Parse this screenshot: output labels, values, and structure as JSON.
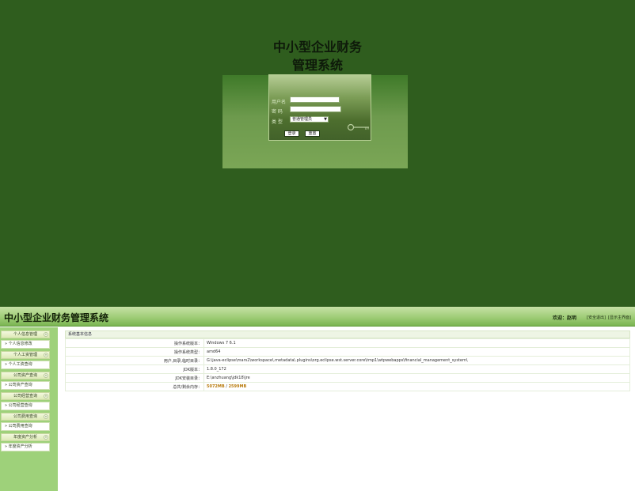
{
  "login": {
    "title_line1": "中小型企业财务",
    "title_line2": "管理系统",
    "username_label": "用户名",
    "password_label": "密 码",
    "role_label": "类 型",
    "role_selected": "普通管理员",
    "login_button": "登录",
    "reset_button": "重置"
  },
  "app": {
    "title": "中小型企业财务管理系统",
    "greeting": "欢迎：赵明",
    "link_logout": "[安全退出]",
    "link_home": "[显示主界面]"
  },
  "sidebar": {
    "groups": [
      {
        "header": "个人信息管理",
        "item": "个人信息修改"
      },
      {
        "header": "个人工资管理",
        "item": "个人工资查询"
      },
      {
        "header": "公司资产查询",
        "item": "公司资产查询"
      },
      {
        "header": "公司经营查询",
        "item": "公司经营查询"
      },
      {
        "header": "公司费用查询",
        "item": "公司费用查询"
      },
      {
        "header": "年度资产分析",
        "item": "年度资产分析"
      }
    ]
  },
  "sysinfo": {
    "title": "系统基本信息",
    "rows": [
      {
        "label": "操作系统版本：",
        "value": "Windows 7  6.1"
      },
      {
        "label": "操作系统类型：",
        "value": "amd64"
      },
      {
        "label": "用户,目录,临时目录：",
        "value": "G:\\java-eclipse\\mars2\\workspace\\.metadata\\.plugins\\org.eclipse.wst.server.core\\tmp1\\wtpwebapps\\financial_management_system\\"
      },
      {
        "label": "JDK版本：",
        "value": "1.8.0_172"
      },
      {
        "label": "JDK安装目录：",
        "value": "E:\\anzhuang\\jdk18\\jre"
      },
      {
        "label": "总共/剩余内存：",
        "value_total": "5072MB",
        "value_sep": " / ",
        "value_free": "2599MB"
      }
    ]
  }
}
